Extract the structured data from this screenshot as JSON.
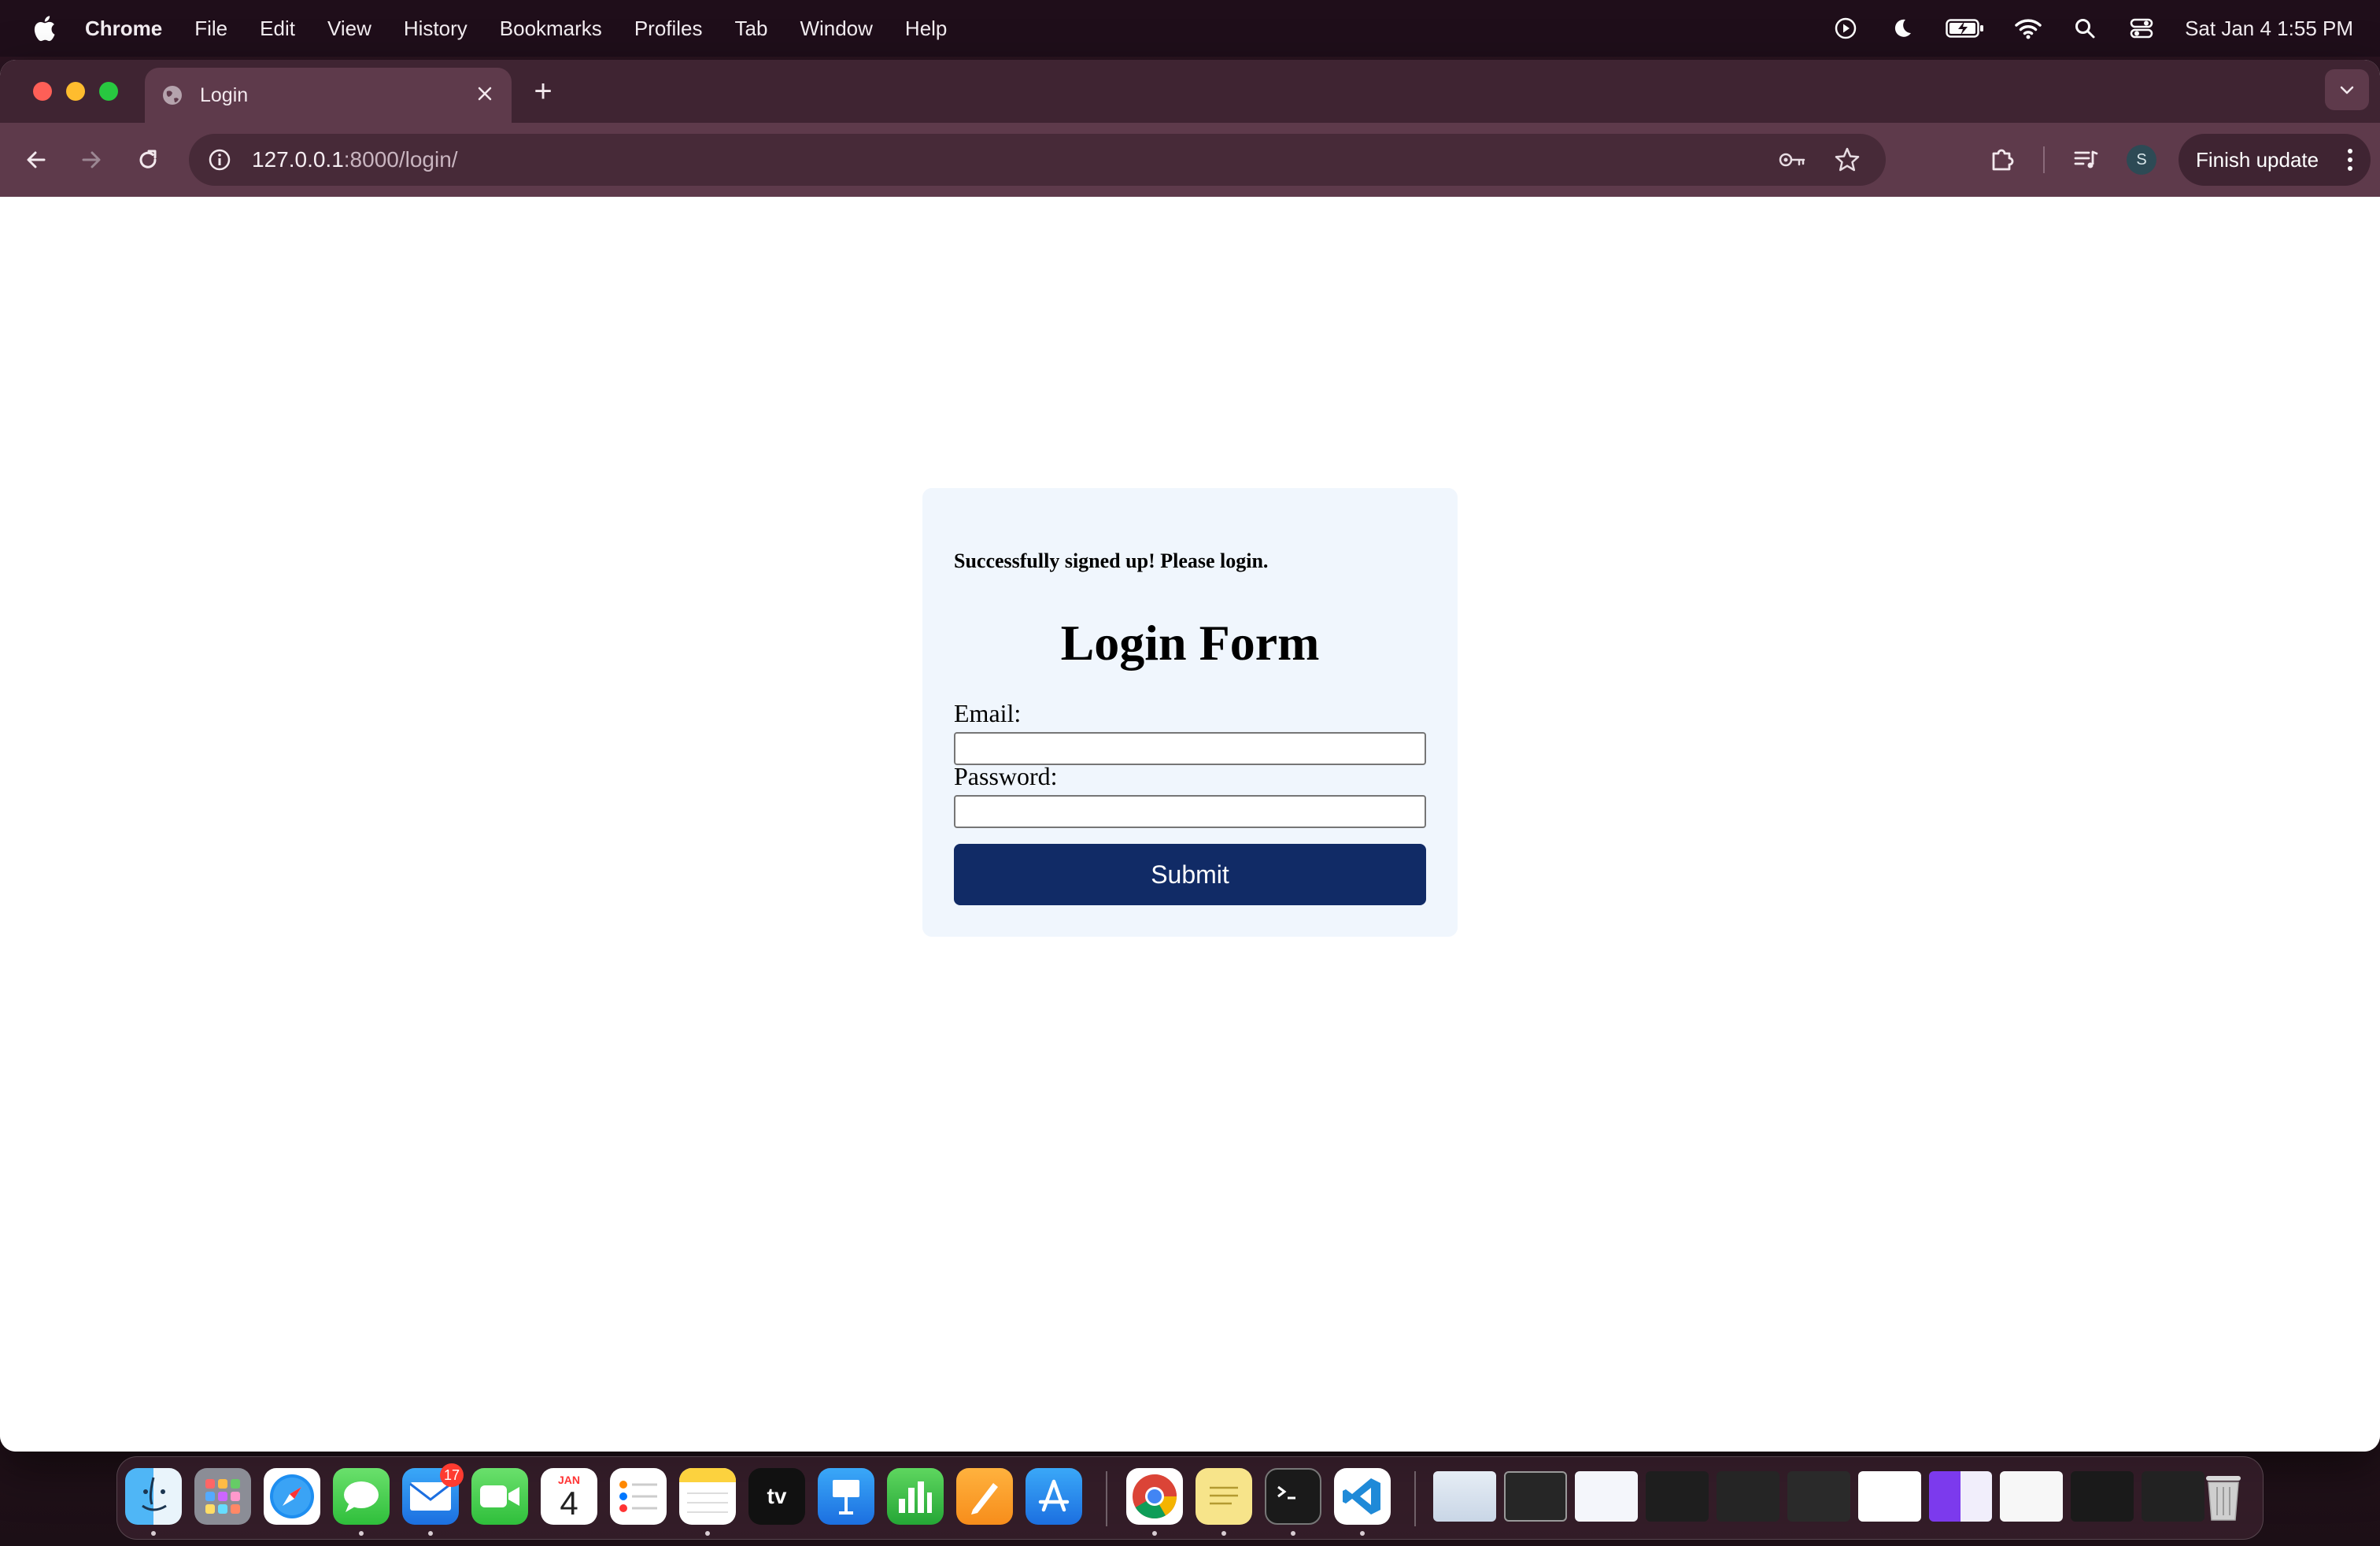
{
  "menubar": {
    "apple_icon": "apple-logo-icon",
    "items": [
      "Chrome",
      "File",
      "Edit",
      "View",
      "History",
      "Bookmarks",
      "Profiles",
      "Tab",
      "Window",
      "Help"
    ],
    "status_icons": [
      "play-circle-icon",
      "moon-icon",
      "battery-charging-icon",
      "wifi-icon",
      "search-icon",
      "control-center-icon"
    ],
    "clock": "Sat Jan 4  1:55 PM"
  },
  "browser": {
    "tab": {
      "title": "Login",
      "favicon": "globe-icon"
    },
    "new_tab_label": "+",
    "url_host": "127.0.0.1",
    "url_rest": ":8000/login/",
    "finish_update_label": "Finish update",
    "profile_initial": "S"
  },
  "page": {
    "message": "Successfully signed up! Please login.",
    "heading": "Login Form",
    "email_label": "Email:",
    "email_value": "",
    "password_label": "Password:",
    "password_value": "",
    "submit_label": "Submit"
  },
  "dock": {
    "apps": [
      "Finder",
      "Launchpad",
      "Safari",
      "Messages",
      "Mail",
      "FaceTime",
      "Calendar",
      "Reminders",
      "Notes",
      "TV",
      "Keynote",
      "Numbers",
      "Pages",
      "App Store",
      "Chrome",
      "Stickies",
      "Terminal",
      "VS Code"
    ],
    "mail_badge": "17",
    "calendar_month": "JAN",
    "calendar_day": "4",
    "tv_label": "tv"
  },
  "colors": {
    "menubar_bg": "#1f0e1a",
    "tabstrip_bg": "#3f2432",
    "toolbar_bg": "#5e3a4b",
    "card_bg": "#f0f6fd",
    "submit_bg": "#112b66"
  }
}
